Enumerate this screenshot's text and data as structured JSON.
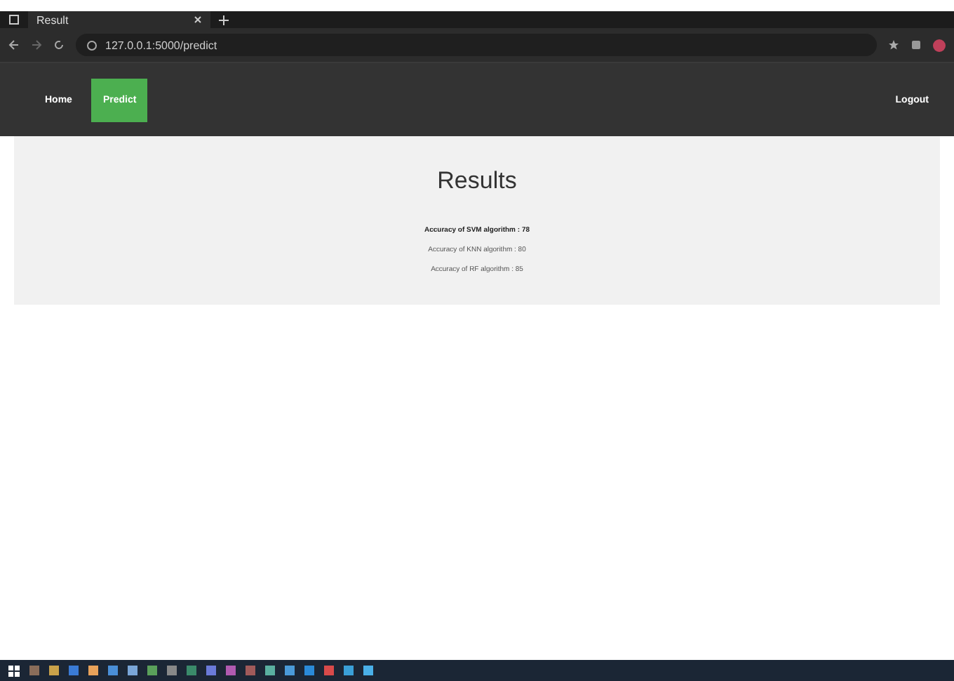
{
  "browser": {
    "tab_title": "Result",
    "url": "127.0.0.1:5000/predict"
  },
  "nav": {
    "items": [
      {
        "label": "Home",
        "selected": false
      },
      {
        "label": "Predict",
        "selected": true
      }
    ],
    "logout": "Logout"
  },
  "results": {
    "title": "Results",
    "lines": [
      {
        "text": "Accuracy of SVM algorithm : 78",
        "bold": true
      },
      {
        "text": "Accuracy of KNN algorithm : 80",
        "bold": false
      },
      {
        "text": "Accuracy of RF algorithm : 85",
        "bold": false
      }
    ]
  },
  "taskbar": {
    "apps": [
      {
        "color": "#8a6d5a"
      },
      {
        "color": "#c9a24a"
      },
      {
        "color": "#3a7bd5"
      },
      {
        "color": "#e8a25a"
      },
      {
        "color": "#4a8fd8"
      },
      {
        "color": "#7aa6d8"
      },
      {
        "color": "#5aa05a"
      },
      {
        "color": "#888888"
      },
      {
        "color": "#3a8a6a"
      },
      {
        "color": "#6a7ad8"
      },
      {
        "color": "#b05ab0"
      },
      {
        "color": "#a05a5a"
      },
      {
        "color": "#5ab0a0"
      },
      {
        "color": "#4a9ad8"
      },
      {
        "color": "#2a8ad8"
      },
      {
        "color": "#d84a4a"
      },
      {
        "color": "#3aa0d8"
      },
      {
        "color": "#4ab0e8"
      }
    ]
  }
}
